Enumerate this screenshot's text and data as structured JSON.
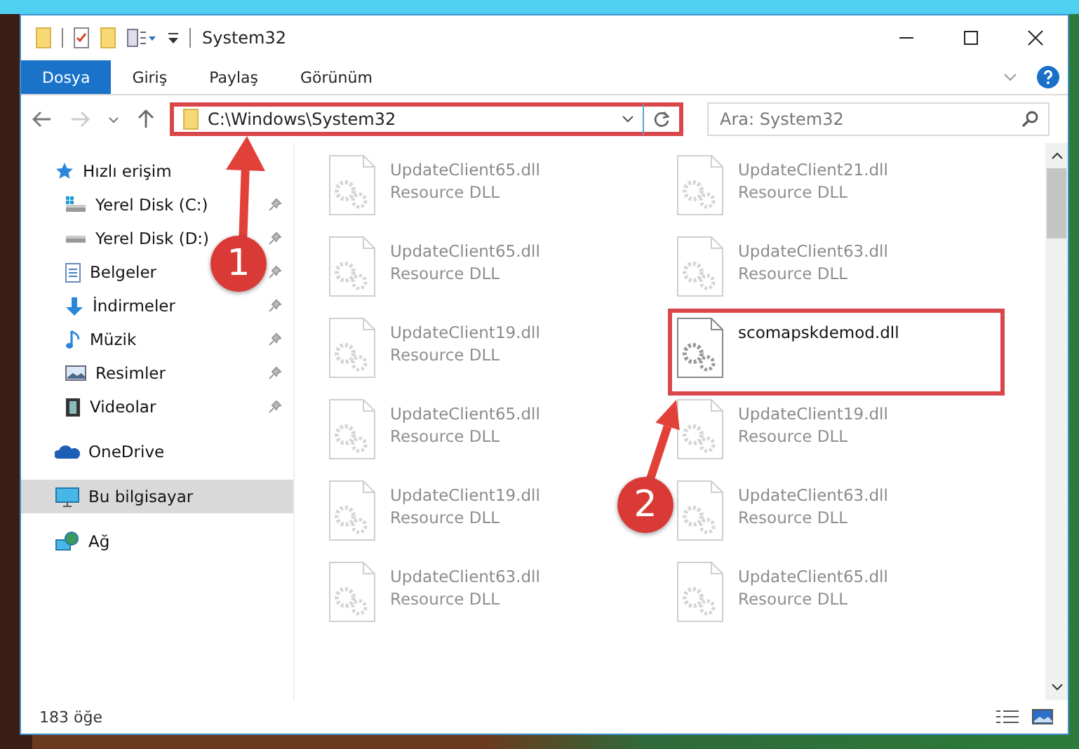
{
  "window": {
    "title": "System32"
  },
  "ribbon_tabs": [
    {
      "label": "Dosya",
      "selected": true
    },
    {
      "label": "Giriş",
      "selected": false
    },
    {
      "label": "Paylaş",
      "selected": false
    },
    {
      "label": "Görünüm",
      "selected": false
    }
  ],
  "address_bar": {
    "path": "C:\\Windows\\System32",
    "highlighted": true
  },
  "search": {
    "placeholder": "Ara: System32"
  },
  "sidebar": {
    "items": [
      {
        "label": "Hızlı erişim",
        "kind": "star",
        "selected": false,
        "children": [
          {
            "label": "Yerel Disk (C:)",
            "kind": "disk",
            "pinned": true,
            "selected": false
          },
          {
            "label": "Yerel Disk (D:)",
            "kind": "disk",
            "pinned": true,
            "selected": false
          },
          {
            "label": "Belgeler",
            "kind": "document",
            "pinned": true,
            "selected": false
          },
          {
            "label": "İndirmeler",
            "kind": "download",
            "pinned": true,
            "selected": false
          },
          {
            "label": "Müzik",
            "kind": "music",
            "pinned": true,
            "selected": false
          },
          {
            "label": "Resimler",
            "kind": "picture",
            "pinned": true,
            "selected": false
          },
          {
            "label": "Videolar",
            "kind": "video",
            "pinned": true,
            "selected": false
          }
        ]
      },
      {
        "label": "OneDrive",
        "kind": "cloud",
        "selected": false
      },
      {
        "label": "Bu bilgisayar",
        "kind": "computer",
        "selected": true
      },
      {
        "label": "Ağ",
        "kind": "network",
        "selected": false
      }
    ]
  },
  "files": [
    {
      "name": "UpdateClient65.dll",
      "type": "Resource DLL",
      "blurred": true,
      "highlighted": false
    },
    {
      "name": "UpdateClient21.dll",
      "type": "Resource DLL",
      "blurred": true,
      "highlighted": false
    },
    {
      "name": "UpdateClient65.dll",
      "type": "Resource DLL",
      "blurred": true,
      "highlighted": false
    },
    {
      "name": "UpdateClient63.dll",
      "type": "Resource DLL",
      "blurred": true,
      "highlighted": false
    },
    {
      "name": "UpdateClient19.dll",
      "type": "Resource DLL",
      "blurred": true,
      "highlighted": false
    },
    {
      "name": "scomapskdemod.dll",
      "blurred": false,
      "highlighted": true
    },
    {
      "name": "UpdateClient65.dll",
      "type": "Resource DLL",
      "blurred": true,
      "highlighted": false
    },
    {
      "name": "UpdateClient19.dll",
      "type": "Resource DLL",
      "blurred": true,
      "highlighted": false
    },
    {
      "name": "UpdateClient19.dll",
      "type": "Resource DLL",
      "blurred": true,
      "highlighted": false
    },
    {
      "name": "UpdateClient63.dll",
      "type": "Resource DLL",
      "blurred": true,
      "highlighted": false
    },
    {
      "name": "UpdateClient63.dll",
      "type": "Resource DLL",
      "blurred": true,
      "highlighted": false
    },
    {
      "name": "UpdateClient65.dll",
      "type": "Resource DLL",
      "blurred": true,
      "highlighted": false
    }
  ],
  "status_bar": {
    "count": "183 öğe"
  },
  "annotations": [
    {
      "number": "1"
    },
    {
      "number": "2"
    }
  ]
}
